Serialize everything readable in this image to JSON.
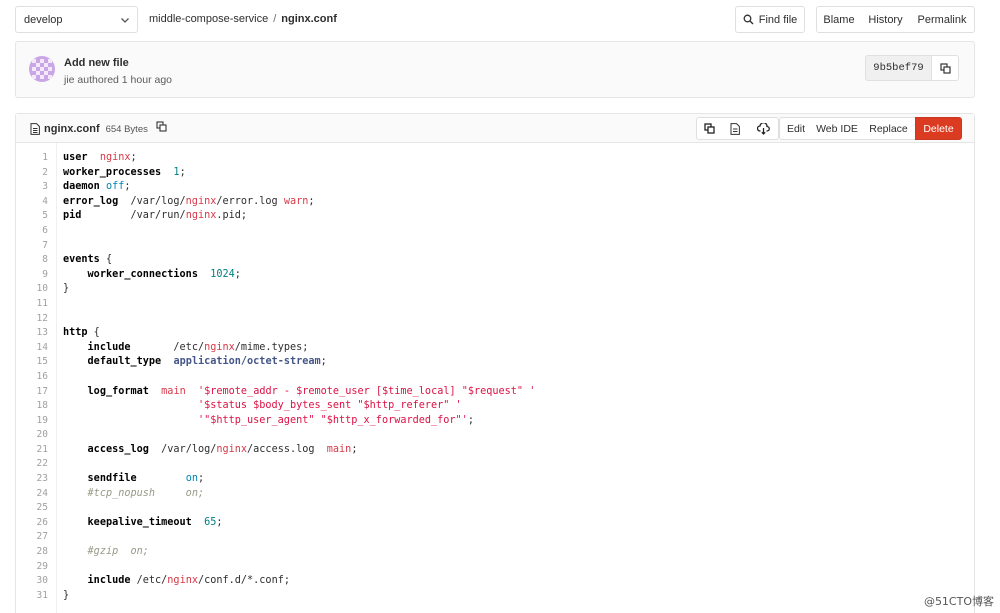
{
  "branch": {
    "name": "develop"
  },
  "breadcrumb": {
    "project": "middle-compose-service",
    "separator": "/",
    "file": "nginx.conf"
  },
  "toolbar": {
    "find_file": "Find file",
    "blame": "Blame",
    "history": "History",
    "permalink": "Permalink"
  },
  "commit": {
    "title": "Add new file",
    "meta": "jie authored 1 hour ago",
    "sha": "9b5bef79"
  },
  "file": {
    "name": "nginx.conf",
    "size": "654 Bytes",
    "actions": {
      "edit": "Edit",
      "web_ide": "Web IDE",
      "replace": "Replace",
      "delete": "Delete"
    },
    "delete_color": "#db3b21"
  },
  "code_lines": [
    {
      "n": "1",
      "t": "user  nginx;"
    },
    {
      "n": "2",
      "t": "worker_processes  1;"
    },
    {
      "n": "3",
      "t": "daemon off;"
    },
    {
      "n": "4",
      "t": "error_log  /var/log/nginx/error.log warn;"
    },
    {
      "n": "5",
      "t": "pid        /var/run/nginx.pid;"
    },
    {
      "n": "6",
      "t": ""
    },
    {
      "n": "7",
      "t": ""
    },
    {
      "n": "8",
      "t": "events {"
    },
    {
      "n": "9",
      "t": "    worker_connections  1024;"
    },
    {
      "n": "10",
      "t": "}"
    },
    {
      "n": "11",
      "t": ""
    },
    {
      "n": "12",
      "t": ""
    },
    {
      "n": "13",
      "t": "http {"
    },
    {
      "n": "14",
      "t": "    include       /etc/nginx/mime.types;"
    },
    {
      "n": "15",
      "t": "    default_type  application/octet-stream;"
    },
    {
      "n": "16",
      "t": ""
    },
    {
      "n": "17",
      "t": "    log_format  main  '$remote_addr - $remote_user [$time_local] \"$request\" '"
    },
    {
      "n": "18",
      "t": "                      '$status $body_bytes_sent \"$http_referer\" '"
    },
    {
      "n": "19",
      "t": "                      '\"$http_user_agent\" \"$http_x_forwarded_for\"';"
    },
    {
      "n": "20",
      "t": ""
    },
    {
      "n": "21",
      "t": "    access_log  /var/log/nginx/access.log  main;"
    },
    {
      "n": "22",
      "t": ""
    },
    {
      "n": "23",
      "t": "    sendfile        on;"
    },
    {
      "n": "24",
      "t": "    #tcp_nopush     on;"
    },
    {
      "n": "25",
      "t": ""
    },
    {
      "n": "26",
      "t": "    keepalive_timeout  65;"
    },
    {
      "n": "27",
      "t": ""
    },
    {
      "n": "28",
      "t": "    #gzip  on;"
    },
    {
      "n": "29",
      "t": ""
    },
    {
      "n": "30",
      "t": "    include /etc/nginx/conf.d/*.conf;"
    },
    {
      "n": "31",
      "t": "}"
    }
  ],
  "watermark": "@51CTO博客"
}
